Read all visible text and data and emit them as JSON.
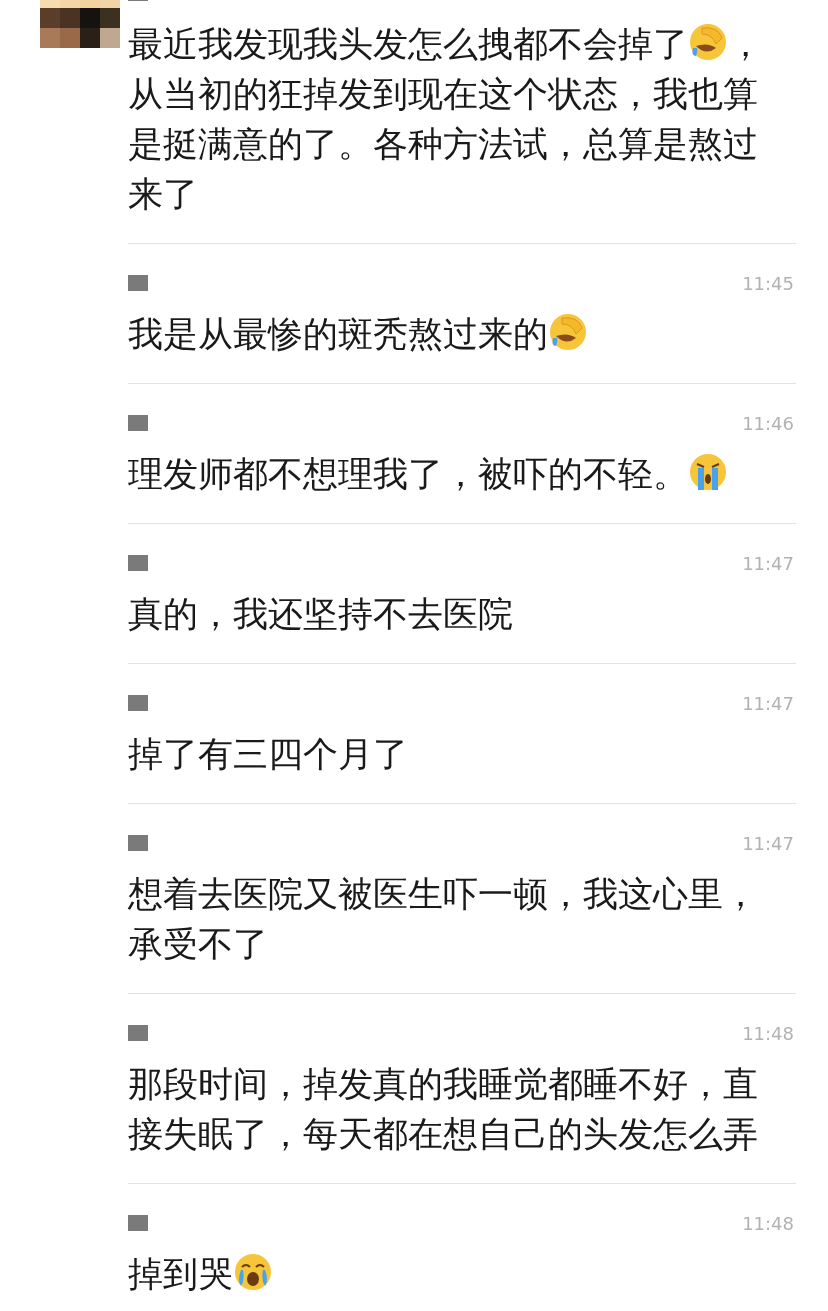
{
  "messages": [
    {
      "parts": [
        {
          "kind": "text",
          "text": "最近我发现我头发怎么拽都不会掉了"
        },
        {
          "kind": "facepalm"
        },
        {
          "kind": "text",
          "text": "，从当初的狂掉发到现在这个状态，我也算是挺满意的了。各种方法试，总算是熬过来了"
        }
      ]
    },
    {
      "time": "11:45",
      "parts": [
        {
          "kind": "text",
          "text": "我是从最惨的斑秃熬过来的"
        },
        {
          "kind": "facepalm"
        }
      ]
    },
    {
      "time": "11:46",
      "parts": [
        {
          "kind": "text",
          "text": "理发师都不想理我了，被吓的不轻。"
        },
        {
          "kind": "crying"
        }
      ]
    },
    {
      "time": "11:47",
      "parts": [
        {
          "kind": "text",
          "text": "真的，我还坚持不去医院"
        }
      ]
    },
    {
      "time": "11:47",
      "parts": [
        {
          "kind": "text",
          "text": "掉了有三四个月了"
        }
      ]
    },
    {
      "time": "11:47",
      "parts": [
        {
          "kind": "text",
          "text": "想着去医院又被医生吓一顿，我这心里，承受不了"
        }
      ]
    },
    {
      "time": "11:48",
      "parts": [
        {
          "kind": "text",
          "text": "那段时间，掉发真的我睡觉都睡不好，直接失眠了，每天都在想自己的头发怎么弄"
        }
      ]
    },
    {
      "time": "11:48",
      "parts": [
        {
          "kind": "text",
          "text": "掉到哭"
        },
        {
          "kind": "sobbing"
        }
      ]
    }
  ]
}
